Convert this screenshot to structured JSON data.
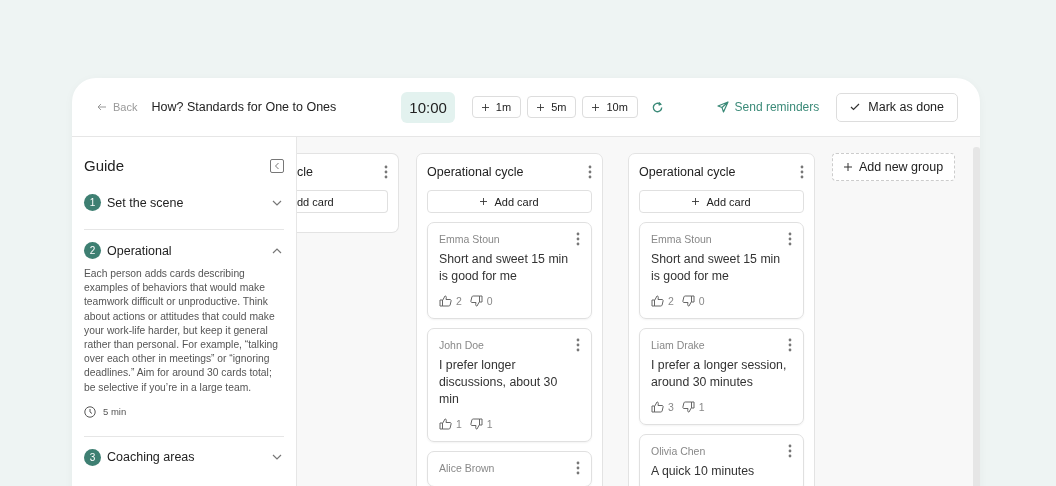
{
  "header": {
    "back": "Back",
    "title": "How? Standards for One to Ones",
    "timer": "10:00",
    "time_buttons": [
      {
        "label": "1m"
      },
      {
        "label": "5m"
      },
      {
        "label": "10m"
      }
    ],
    "send_reminders": "Send reminders",
    "mark_done": "Mark as done"
  },
  "guide": {
    "title": "Guide",
    "steps": [
      {
        "number": "1",
        "title": "Set the scene",
        "expanded": false
      },
      {
        "number": "2",
        "title": "Operational",
        "expanded": true,
        "description": "Each person adds cards describing examples of behaviors that would make teamwork difficult or unproductive. Think about actions or attitudes that could make your work-life harder, but keep it general rather than personal. For example, “talking over each other in meetings” or “ignoring deadlines.” Aim for around 30 cards total; be selective if you’re in a large team.",
        "duration": "5 min"
      },
      {
        "number": "3",
        "title": "Coaching areas",
        "expanded": false
      }
    ]
  },
  "board": {
    "columns": [
      {
        "kind": "clipped",
        "title": "cle",
        "add_label": "dd card"
      },
      {
        "kind": "full",
        "title": "Operational cycle",
        "add_label": "Add card",
        "cards": [
          {
            "author": "Emma Stoun",
            "text": "Short and sweet 15 min is good for me",
            "likes": "2",
            "dislikes": "0"
          },
          {
            "author": "John Doe",
            "text": "I prefer longer discussions, about 30 min",
            "likes": "1",
            "dislikes": "1"
          },
          {
            "author": "Alice Brown"
          }
        ]
      },
      {
        "kind": "full",
        "title": "Operational cycle",
        "add_label": "Add card",
        "cards": [
          {
            "author": "Emma Stoun",
            "text": "Short and sweet 15 min is good for me",
            "likes": "2",
            "dislikes": "0"
          },
          {
            "author": "Liam Drake",
            "text": "I prefer a longer session, around 30 minutes",
            "likes": "3",
            "dislikes": "1"
          },
          {
            "author": "Olivia Chen",
            "text": "A quick 10 minutes"
          }
        ]
      }
    ],
    "add_group": "Add new group"
  }
}
